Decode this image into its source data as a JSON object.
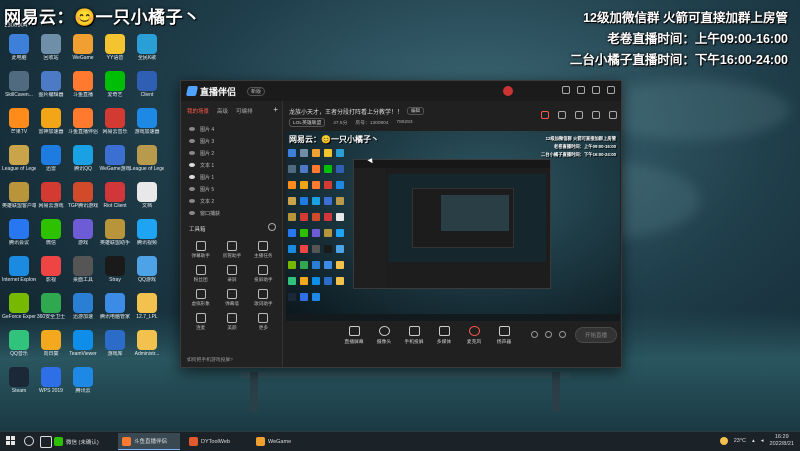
{
  "overlay": {
    "brand": "网易云：😊一只小橘子丶",
    "room_id": "1300904",
    "notice_lines": [
      "12级加微信群  火箭可直接加群上房管",
      "老卷直播时间：上午09:00-16:00",
      "二台小橘子直播时间：下午16:00-24:00"
    ]
  },
  "desktop_icons": [
    {
      "label": "此电脑",
      "icon": "computer-icon",
      "color": "#3d7fd9"
    },
    {
      "label": "回收站",
      "icon": "recycle-bin-icon",
      "color": "#6f8fa8"
    },
    {
      "label": "WeGame",
      "icon": "wegame-icon",
      "color": "#f0a030"
    },
    {
      "label": "YY语音",
      "icon": "yy-icon",
      "color": "#f4c430"
    },
    {
      "label": "全民K歌",
      "icon": "karaoke-icon",
      "color": "#2a9fd6"
    },
    {
      "label": "SkillCaven...",
      "icon": "app-icon",
      "color": "#506a80"
    },
    {
      "label": "图片编辑器",
      "icon": "image-editor-icon",
      "color": "#4c7ac4"
    },
    {
      "label": "斗鱼直播",
      "icon": "douyu-icon",
      "color": "#ff7a2e"
    },
    {
      "label": "爱奇艺",
      "icon": "iqiyi-icon",
      "color": "#00be06"
    },
    {
      "label": "Client",
      "icon": "client-icon",
      "color": "#2f5fb2"
    },
    {
      "label": "芒果TV",
      "icon": "mango-icon",
      "color": "#ff8c1a"
    },
    {
      "label": "雷神加速器",
      "icon": "thunder-icon",
      "color": "#f2a516"
    },
    {
      "label": "斗鱼直播伴侣",
      "icon": "douyu-companion-icon",
      "color": "#ff7a2e"
    },
    {
      "label": "网易云音乐",
      "icon": "music-icon",
      "color": "#d33a31"
    },
    {
      "label": "游戏加速器",
      "icon": "accelerator-icon",
      "color": "#1e88e5"
    },
    {
      "label": "League of Legends",
      "icon": "lol-icon",
      "color": "#c9a44a"
    },
    {
      "label": "迅雷",
      "icon": "xunlei-icon",
      "color": "#1e7be0"
    },
    {
      "label": "腾讯QQ",
      "icon": "qq-icon",
      "color": "#1aa1e4"
    },
    {
      "label": "WeGame游戏",
      "icon": "wegame-icon",
      "color": "#3b6fd1"
    },
    {
      "label": "League of Legends",
      "icon": "lol-icon",
      "color": "#b89a4c"
    },
    {
      "label": "英雄联盟客户端",
      "icon": "lol-client-icon",
      "color": "#b8953a"
    },
    {
      "label": "网易云游戏",
      "icon": "netease-game-icon",
      "color": "#d33a31"
    },
    {
      "label": "TGP腾讯游戏",
      "icon": "tgp-icon",
      "color": "#d14a2a"
    },
    {
      "label": "Riot Client",
      "icon": "riot-icon",
      "color": "#d13639"
    },
    {
      "label": "文档",
      "icon": "document-icon",
      "color": "#e8e8e8"
    },
    {
      "label": "腾讯会议",
      "icon": "meeting-icon",
      "color": "#2877f0"
    },
    {
      "label": "微信",
      "icon": "wechat-icon",
      "color": "#2dc100"
    },
    {
      "label": "游戏",
      "icon": "game-icon",
      "color": "#6e5bd6"
    },
    {
      "label": "英雄联盟助手",
      "icon": "lol-helper-icon",
      "color": "#b8953a"
    },
    {
      "label": "腾讯视频",
      "icon": "tencent-video-icon",
      "color": "#1ea4f2"
    },
    {
      "label": "Internet Explorer",
      "icon": "ie-icon",
      "color": "#1a8be0"
    },
    {
      "label": "影视",
      "icon": "video-icon",
      "color": "#ee4444"
    },
    {
      "label": "桌面工具",
      "icon": "tool-icon",
      "color": "#555555"
    },
    {
      "label": "Stray",
      "icon": "stray-icon",
      "color": "#1a1a1a"
    },
    {
      "label": "QQ游戏",
      "icon": "qq-game-icon",
      "color": "#4ea3e6"
    },
    {
      "label": "GeForce Experience",
      "icon": "nvidia-icon",
      "color": "#76b900"
    },
    {
      "label": "360安全卫士",
      "icon": "security-icon",
      "color": "#2fa84f"
    },
    {
      "label": "迅游加速",
      "icon": "boost-icon",
      "color": "#2a7fd4"
    },
    {
      "label": "腾讯电脑管家",
      "icon": "pc-manager-icon",
      "color": "#3c8ce7"
    },
    {
      "label": "12.7_LPL",
      "icon": "folder-icon",
      "color": "#f2c14e"
    },
    {
      "label": "QQ音乐",
      "icon": "qq-music-icon",
      "color": "#31c27c"
    },
    {
      "label": "向日葵",
      "icon": "sunflower-icon",
      "color": "#f4a81d"
    },
    {
      "label": "TeamViewer",
      "icon": "teamviewer-icon",
      "color": "#0e8ee9"
    },
    {
      "label": "游戏库",
      "icon": "library-icon",
      "color": "#2c6cc9"
    },
    {
      "label": "Administr...",
      "icon": "user-folder-icon",
      "color": "#f2c14e"
    },
    {
      "label": "Steam",
      "icon": "steam-icon",
      "color": "#1b2838"
    },
    {
      "label": "WPS 2019",
      "icon": "wps-icon",
      "color": "#2e6fe8"
    },
    {
      "label": "腾讯云",
      "icon": "cloud-icon",
      "color": "#1e88e5"
    }
  ],
  "app": {
    "name": "直播伴侣",
    "version": "新版",
    "tabs": [
      "我的场景",
      "高级",
      "可编排"
    ],
    "scenes": [
      {
        "label": "图片 4",
        "on": false
      },
      {
        "label": "图片 3",
        "on": false
      },
      {
        "label": "图片 2",
        "on": false
      },
      {
        "label": "文本 1",
        "on": true
      },
      {
        "label": "图片 1",
        "on": true
      },
      {
        "label": "图片 5",
        "on": false
      },
      {
        "label": "文本 2",
        "on": false
      },
      {
        "label": "窗口捕获",
        "on": false
      }
    ],
    "tools_title": "工具箱",
    "tools": [
      "弹幕助手",
      "房管助手",
      "主播任务",
      "粉丝团",
      "录屏",
      "投屏助手",
      "虚拟形象",
      "弹幕墙",
      "歌词助手",
      "连麦",
      "美颜",
      "更多"
    ],
    "left_footer": "如何把手机游戏投屏?",
    "stream_title": "龙族小天才，王者分段打阵看上分教学！！",
    "edit_label": "编辑",
    "meta": {
      "category": "LOL英雄联盟",
      "score": "47.5分",
      "room_label": "房号：",
      "room": "1300904",
      "viewers": "786293"
    },
    "controls": [
      "直播屏幕",
      "摄像头",
      "手机投屏",
      "多媒体",
      "麦克风",
      "扬声器"
    ],
    "golive_label": "开始直播",
    "preview_brand": "网易云：😊一只小橘子丶",
    "preview_notice_lines": [
      "12级加微信群  火箭可直接加群上房管",
      "老卷直播时间：上午09:00-16:00",
      "二台小橘子直播时间：下午16:00-24:00"
    ]
  },
  "taskbar": {
    "apps": [
      {
        "label": "微信 (未确认)",
        "icon": "wechat-icon",
        "color": "#2dc100",
        "active": false
      },
      {
        "label": "斗鱼直播伴侣",
        "icon": "douyu-icon",
        "color": "#ff7a2e",
        "active": true
      },
      {
        "label": "DYToolWeb",
        "icon": "web-icon",
        "color": "#e05a2b",
        "active": false
      },
      {
        "label": "WeGame",
        "icon": "wegame-icon",
        "color": "#f0a030",
        "active": false
      }
    ],
    "temperature": "23°C",
    "time": "16:29",
    "date": "2022/8/21"
  }
}
